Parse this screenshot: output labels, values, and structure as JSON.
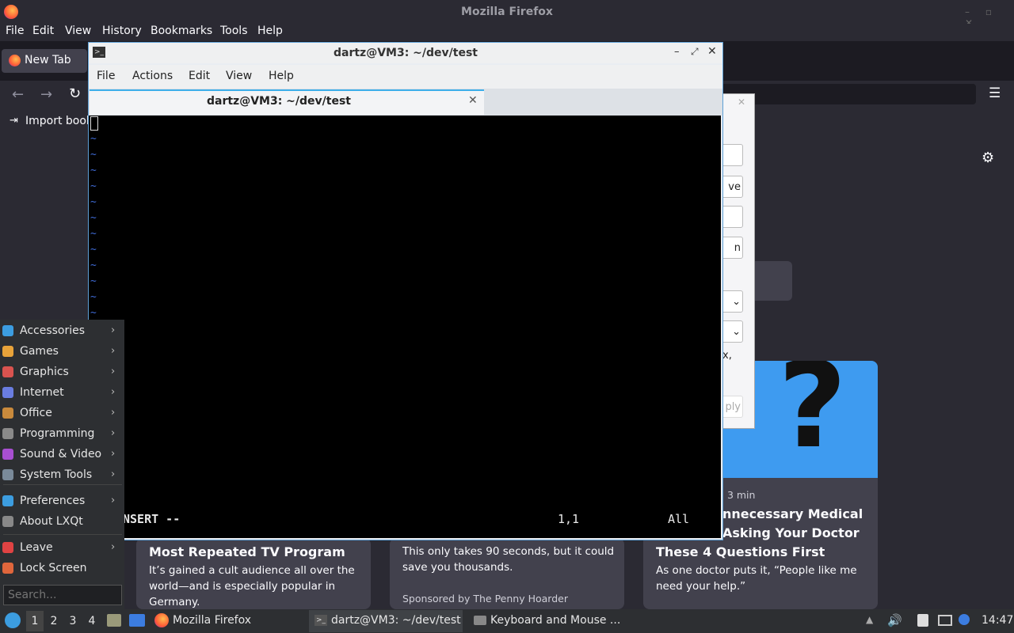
{
  "firefox": {
    "window_title": "Mozilla Firefox",
    "menu": [
      "File",
      "Edit",
      "View",
      "History",
      "Bookmarks",
      "Tools",
      "Help"
    ],
    "tab_label": "New Tab",
    "bookmarks_import": "Import book",
    "cards": [
      {
        "title": "Most Repeated TV Program",
        "text": "It’s gained a cult audience all over the world—and is especially popular in Germany."
      },
      {
        "text": "This only takes 90 seconds, but it could save you thousands.",
        "sponsor": "Sponsored by The Penny Hoarder"
      },
      {
        "meta": "· 3 min",
        "title_part": "nnecessary Medical",
        "title_line2": "Asking Your Doctor",
        "title_line3": "These 4 Questions First",
        "text": "As one doctor puts it, “People like me need your help.”"
      }
    ],
    "dialog_fragments": [
      "ve",
      "n",
      "x,",
      "ply"
    ]
  },
  "terminal": {
    "title": "dartz@VM3: ~/dev/test",
    "menu": [
      "File",
      "Actions",
      "Edit",
      "View",
      "Help"
    ],
    "tab_title": "dartz@VM3: ~/dev/test",
    "tilde_lines": 12,
    "status_mode": "NSERT --",
    "status_pos": "1,1",
    "status_scroll": "All"
  },
  "start_menu": {
    "items": [
      {
        "label": "Accessories",
        "icon": "accessories-icon",
        "color": "#3c9de0",
        "submenu": true
      },
      {
        "label": "Games",
        "icon": "games-icon",
        "color": "#e8a33a",
        "submenu": true
      },
      {
        "label": "Graphics",
        "icon": "graphics-icon",
        "color": "#d9534f",
        "submenu": true
      },
      {
        "label": "Internet",
        "icon": "internet-icon",
        "color": "#6a7de0",
        "submenu": true
      },
      {
        "label": "Office",
        "icon": "office-icon",
        "color": "#c98a3c",
        "submenu": true
      },
      {
        "label": "Programming",
        "icon": "programming-icon",
        "color": "#8a8a8a",
        "submenu": true
      },
      {
        "label": "Sound & Video",
        "icon": "sound-video-icon",
        "color": "#a84fd1",
        "submenu": true
      },
      {
        "label": "System Tools",
        "icon": "system-tools-icon",
        "color": "#7a8a9a",
        "submenu": true
      },
      {
        "label": "Preferences",
        "icon": "preferences-icon",
        "color": "#3c9de0",
        "submenu": true
      },
      {
        "label": "About LXQt",
        "icon": "about-icon",
        "color": "#888888",
        "submenu": false
      },
      {
        "label": "Leave",
        "icon": "leave-icon",
        "color": "#e04343",
        "submenu": true
      },
      {
        "label": "Lock Screen",
        "icon": "lock-icon",
        "color": "#e0663c",
        "submenu": false
      }
    ],
    "search_placeholder": "Search..."
  },
  "taskbar": {
    "desktops": [
      "1",
      "2",
      "3",
      "4"
    ],
    "tasks": [
      "Mozilla Firefox",
      "dartz@VM3: ~/dev/test",
      "Keyboard and Mouse ..."
    ],
    "clock": "14:47"
  }
}
